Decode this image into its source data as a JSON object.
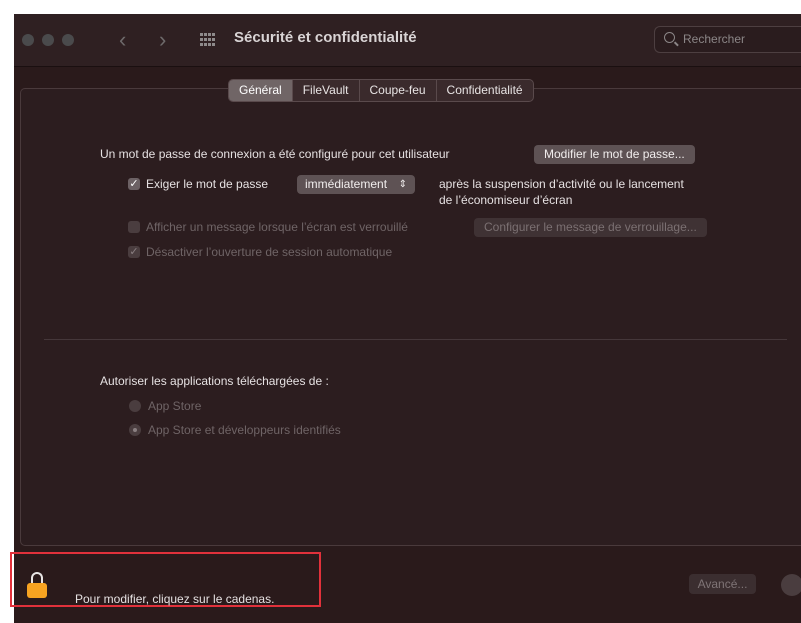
{
  "window": {
    "title": "Sécurité et confidentialité"
  },
  "search": {
    "placeholder": "Rechercher"
  },
  "tabs": [
    {
      "label": "Général",
      "active": true
    },
    {
      "label": "FileVault",
      "active": false
    },
    {
      "label": "Coupe-feu",
      "active": false
    },
    {
      "label": "Confidentialité",
      "active": false
    }
  ],
  "general": {
    "password_set_text": "Un mot de passe de connexion a été configuré pour cet utilisateur",
    "change_password_button": "Modifier le mot de passe...",
    "require_password_label": "Exiger le mot de passe",
    "require_password_checked": true,
    "require_password_delay": "immédiatement",
    "require_password_suffix_line1": "après la suspension d’activité ou le lancement",
    "require_password_suffix_line2": "de l’économiseur d’écran",
    "show_message_label": "Afficher un message lorsque l’écran est verrouillé",
    "show_message_checked": false,
    "set_lock_message_button": "Configurer le message de verrouillage...",
    "disable_autologin_label": "Désactiver l’ouverture de session automatique",
    "disable_autologin_checked": true,
    "allow_apps_label": "Autoriser les applications téléchargées de :",
    "radio_options": [
      {
        "label": "App Store",
        "selected": false
      },
      {
        "label": "App Store et développeurs identifiés",
        "selected": true
      }
    ]
  },
  "footer": {
    "lock_text": "Pour modifier, cliquez sur le cadenas.",
    "advanced_button": "Avancé..."
  },
  "colors": {
    "highlight_box": "#e1313b",
    "lock_body": "#f7a321"
  }
}
